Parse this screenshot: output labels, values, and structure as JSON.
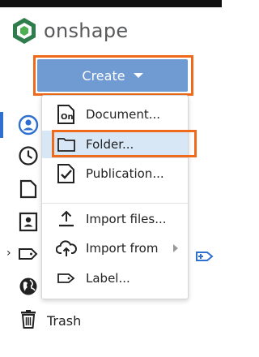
{
  "brand": {
    "name": "onshape",
    "accent": "#6f9bd2",
    "highlight": "#ef6a1a"
  },
  "create_button": {
    "label": "Create",
    "icon": "chevron-down-icon"
  },
  "sidebar": {
    "icons": [
      "user-circle-icon",
      "clock-icon",
      "document-icon",
      "contact-card-icon",
      "label-tag-icon",
      "globe-icon"
    ],
    "trash_label": "Trash"
  },
  "create_menu": {
    "items": [
      {
        "label": "Document...",
        "icon": "onshape-document-icon"
      },
      {
        "label": "Folder...",
        "icon": "folder-icon",
        "hovered": true
      },
      {
        "label": "Publication...",
        "icon": "publication-icon"
      },
      {
        "label": "Import files...",
        "icon": "upload-icon"
      },
      {
        "label": "Import from",
        "icon": "cloud-upload-icon",
        "has_submenu": true
      },
      {
        "label": "Label...",
        "icon": "label-tag-icon"
      }
    ]
  }
}
